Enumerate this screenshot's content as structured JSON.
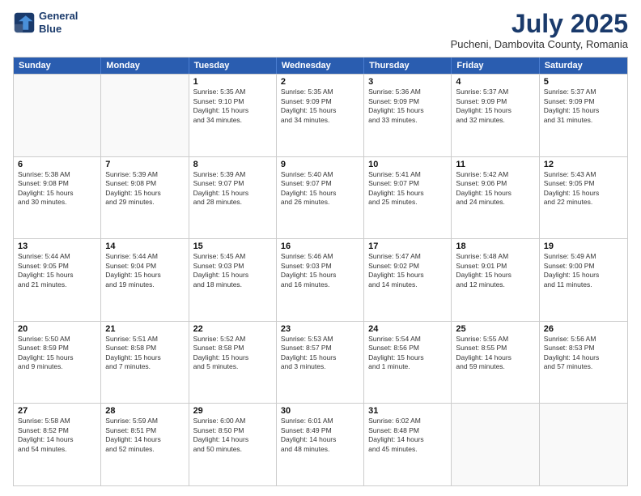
{
  "header": {
    "logo_line1": "General",
    "logo_line2": "Blue",
    "month_year": "July 2025",
    "location": "Pucheni, Dambovita County, Romania"
  },
  "weekdays": [
    "Sunday",
    "Monday",
    "Tuesday",
    "Wednesday",
    "Thursday",
    "Friday",
    "Saturday"
  ],
  "rows": [
    [
      {
        "day": "",
        "text": ""
      },
      {
        "day": "",
        "text": ""
      },
      {
        "day": "1",
        "text": "Sunrise: 5:35 AM\nSunset: 9:10 PM\nDaylight: 15 hours\nand 34 minutes."
      },
      {
        "day": "2",
        "text": "Sunrise: 5:35 AM\nSunset: 9:09 PM\nDaylight: 15 hours\nand 34 minutes."
      },
      {
        "day": "3",
        "text": "Sunrise: 5:36 AM\nSunset: 9:09 PM\nDaylight: 15 hours\nand 33 minutes."
      },
      {
        "day": "4",
        "text": "Sunrise: 5:37 AM\nSunset: 9:09 PM\nDaylight: 15 hours\nand 32 minutes."
      },
      {
        "day": "5",
        "text": "Sunrise: 5:37 AM\nSunset: 9:09 PM\nDaylight: 15 hours\nand 31 minutes."
      }
    ],
    [
      {
        "day": "6",
        "text": "Sunrise: 5:38 AM\nSunset: 9:08 PM\nDaylight: 15 hours\nand 30 minutes."
      },
      {
        "day": "7",
        "text": "Sunrise: 5:39 AM\nSunset: 9:08 PM\nDaylight: 15 hours\nand 29 minutes."
      },
      {
        "day": "8",
        "text": "Sunrise: 5:39 AM\nSunset: 9:07 PM\nDaylight: 15 hours\nand 28 minutes."
      },
      {
        "day": "9",
        "text": "Sunrise: 5:40 AM\nSunset: 9:07 PM\nDaylight: 15 hours\nand 26 minutes."
      },
      {
        "day": "10",
        "text": "Sunrise: 5:41 AM\nSunset: 9:07 PM\nDaylight: 15 hours\nand 25 minutes."
      },
      {
        "day": "11",
        "text": "Sunrise: 5:42 AM\nSunset: 9:06 PM\nDaylight: 15 hours\nand 24 minutes."
      },
      {
        "day": "12",
        "text": "Sunrise: 5:43 AM\nSunset: 9:05 PM\nDaylight: 15 hours\nand 22 minutes."
      }
    ],
    [
      {
        "day": "13",
        "text": "Sunrise: 5:44 AM\nSunset: 9:05 PM\nDaylight: 15 hours\nand 21 minutes."
      },
      {
        "day": "14",
        "text": "Sunrise: 5:44 AM\nSunset: 9:04 PM\nDaylight: 15 hours\nand 19 minutes."
      },
      {
        "day": "15",
        "text": "Sunrise: 5:45 AM\nSunset: 9:03 PM\nDaylight: 15 hours\nand 18 minutes."
      },
      {
        "day": "16",
        "text": "Sunrise: 5:46 AM\nSunset: 9:03 PM\nDaylight: 15 hours\nand 16 minutes."
      },
      {
        "day": "17",
        "text": "Sunrise: 5:47 AM\nSunset: 9:02 PM\nDaylight: 15 hours\nand 14 minutes."
      },
      {
        "day": "18",
        "text": "Sunrise: 5:48 AM\nSunset: 9:01 PM\nDaylight: 15 hours\nand 12 minutes."
      },
      {
        "day": "19",
        "text": "Sunrise: 5:49 AM\nSunset: 9:00 PM\nDaylight: 15 hours\nand 11 minutes."
      }
    ],
    [
      {
        "day": "20",
        "text": "Sunrise: 5:50 AM\nSunset: 8:59 PM\nDaylight: 15 hours\nand 9 minutes."
      },
      {
        "day": "21",
        "text": "Sunrise: 5:51 AM\nSunset: 8:58 PM\nDaylight: 15 hours\nand 7 minutes."
      },
      {
        "day": "22",
        "text": "Sunrise: 5:52 AM\nSunset: 8:58 PM\nDaylight: 15 hours\nand 5 minutes."
      },
      {
        "day": "23",
        "text": "Sunrise: 5:53 AM\nSunset: 8:57 PM\nDaylight: 15 hours\nand 3 minutes."
      },
      {
        "day": "24",
        "text": "Sunrise: 5:54 AM\nSunset: 8:56 PM\nDaylight: 15 hours\nand 1 minute."
      },
      {
        "day": "25",
        "text": "Sunrise: 5:55 AM\nSunset: 8:55 PM\nDaylight: 14 hours\nand 59 minutes."
      },
      {
        "day": "26",
        "text": "Sunrise: 5:56 AM\nSunset: 8:53 PM\nDaylight: 14 hours\nand 57 minutes."
      }
    ],
    [
      {
        "day": "27",
        "text": "Sunrise: 5:58 AM\nSunset: 8:52 PM\nDaylight: 14 hours\nand 54 minutes."
      },
      {
        "day": "28",
        "text": "Sunrise: 5:59 AM\nSunset: 8:51 PM\nDaylight: 14 hours\nand 52 minutes."
      },
      {
        "day": "29",
        "text": "Sunrise: 6:00 AM\nSunset: 8:50 PM\nDaylight: 14 hours\nand 50 minutes."
      },
      {
        "day": "30",
        "text": "Sunrise: 6:01 AM\nSunset: 8:49 PM\nDaylight: 14 hours\nand 48 minutes."
      },
      {
        "day": "31",
        "text": "Sunrise: 6:02 AM\nSunset: 8:48 PM\nDaylight: 14 hours\nand 45 minutes."
      },
      {
        "day": "",
        "text": ""
      },
      {
        "day": "",
        "text": ""
      }
    ]
  ]
}
